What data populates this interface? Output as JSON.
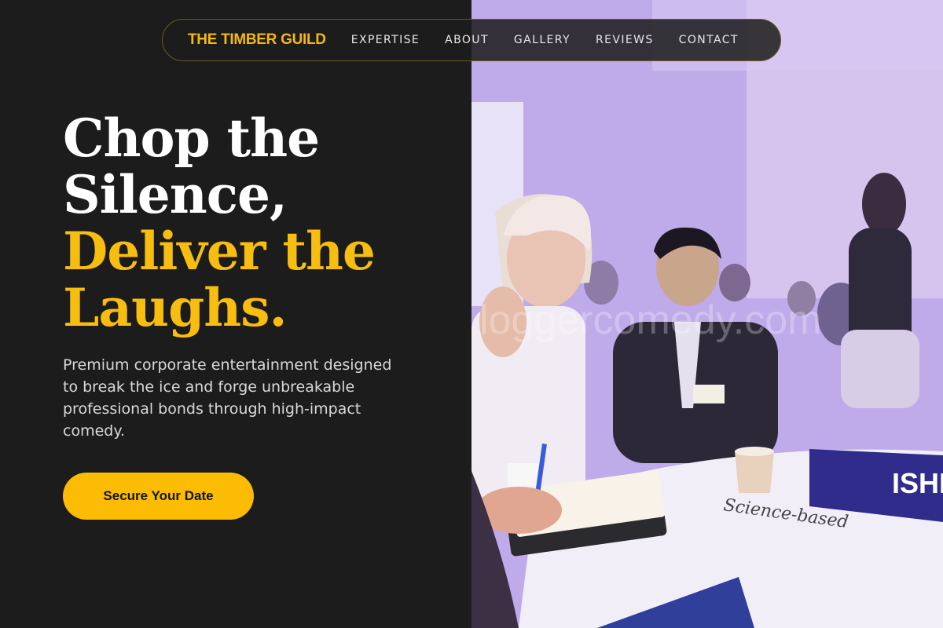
{
  "nav": {
    "brand": "THE TIMBER GUILD",
    "links": [
      {
        "label": "EXPERTISE"
      },
      {
        "label": "ABOUT"
      },
      {
        "label": "GALLERY"
      },
      {
        "label": "REVIEWS"
      },
      {
        "label": "CONTACT"
      }
    ]
  },
  "hero": {
    "headline_white_1": "Chop the",
    "headline_white_2": "Silence,",
    "headline_gold_1": "Deliver the",
    "headline_gold_2": "Laughs.",
    "description": "Premium corporate entertainment designed to break the ice and forge unbreakable professional bonds through high-impact comedy.",
    "cta_label": "Secure Your Date"
  },
  "photo": {
    "name_card_text": "ISHI",
    "notepad_text": "Science-based",
    "watermark": "loggercomedy.com"
  },
  "colors": {
    "accent": "#f7bd10",
    "background": "#1c1c1c",
    "nav_border": "#6b5a24"
  }
}
